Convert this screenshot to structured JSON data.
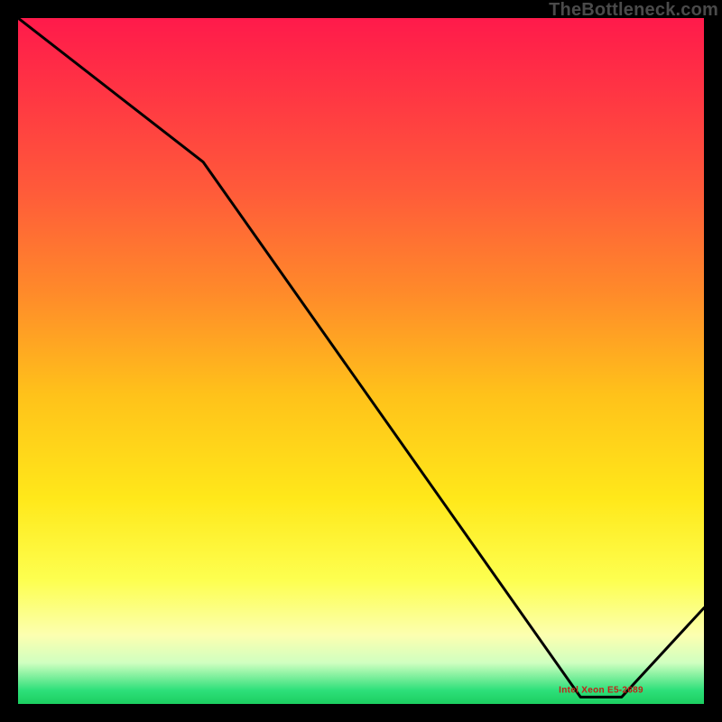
{
  "attribution": "TheBottleneck.com",
  "min_label": "Intel Xeon E5-2689",
  "colors": {
    "curve": "#000000",
    "min_label": "#c42018",
    "attribution": "#4a4a4a"
  },
  "chart_data": {
    "type": "line",
    "title": "",
    "xlabel": "",
    "ylabel": "",
    "xlim": [
      0,
      100
    ],
    "ylim": [
      0,
      100
    ],
    "x": [
      0,
      27,
      82,
      88,
      100
    ],
    "y": [
      100,
      79,
      1,
      1,
      14
    ],
    "annotations": [
      {
        "text": "Intel Xeon E5-2689",
        "x": 85,
        "y": 2
      }
    ],
    "grid": false,
    "legend": false
  }
}
